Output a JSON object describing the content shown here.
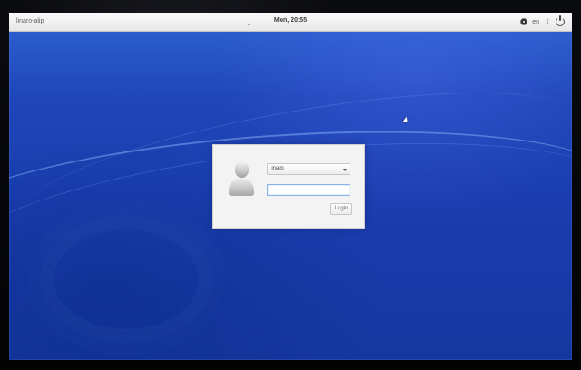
{
  "topbar": {
    "hostname": "linaro-alip",
    "clock": "Mon, 20:55",
    "status": {
      "language": "en",
      "icons": [
        "accessibility-icon",
        "bluetooth-icon",
        "power-icon"
      ]
    }
  },
  "login": {
    "selected_user": "linaro",
    "password_value": "",
    "button_label": "Login"
  },
  "colors": {
    "desktop_primary": "#1d43b6",
    "desktop_highlight": "#7ea8ff",
    "panel": "#ececec",
    "dialog": "#f3f3f3",
    "input_focus": "#8cb4ea"
  }
}
